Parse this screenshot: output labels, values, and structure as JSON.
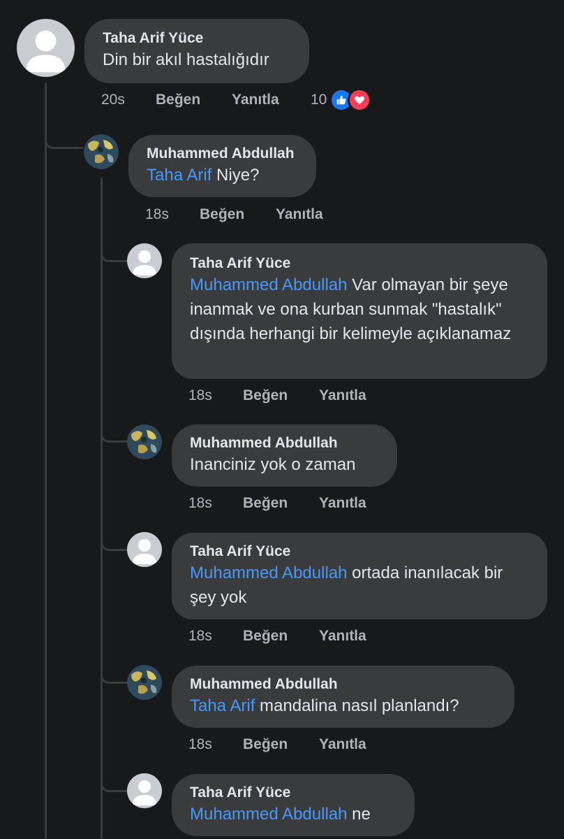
{
  "colors": {
    "background": "#18191a",
    "bubble": "#3a3b3c",
    "mention": "#4599ff",
    "action_text": "#b0b3b8",
    "like_reaction": "#1877f2",
    "love_reaction": "#f33e58"
  },
  "root_comment": {
    "author": "Taha Arif Yüce",
    "text": "Din bir akıl hastalığıdır",
    "time": "20s",
    "like_label": "Beğen",
    "reply_label": "Yanıtla",
    "reaction_count": "10",
    "reaction_icons": [
      "like-icon",
      "love-icon"
    ]
  },
  "replies": [
    {
      "author": "Muhammed Abdullah",
      "mention": "Taha Arif",
      "text": " Niye?",
      "time": "18s",
      "like_label": "Beğen",
      "reply_label": "Yanıtla"
    },
    {
      "author": "Taha Arif Yüce",
      "mention": "Muhammed Abdullah",
      "text": " Var olmayan bir şeye inanmak ve ona kurban sunmak \"hastalık\" dışında herhangi bir kelimeyle açıklanamaz",
      "time": "18s",
      "like_label": "Beğen",
      "reply_label": "Yanıtla"
    },
    {
      "author": "Muhammed Abdullah",
      "mention": "",
      "text": "Inanciniz yok o zaman",
      "time": "18s",
      "like_label": "Beğen",
      "reply_label": "Yanıtla"
    },
    {
      "author": "Taha Arif Yüce",
      "mention": "Muhammed Abdullah",
      "text": " ortada inanılacak bir şey yok",
      "time": "18s",
      "like_label": "Beğen",
      "reply_label": "Yanıtla"
    },
    {
      "author": "Muhammed Abdullah",
      "mention": "Taha Arif",
      "text": " mandalina nasıl planlandı?",
      "time": "18s",
      "like_label": "Beğen",
      "reply_label": "Yanıtla"
    },
    {
      "author": "Taha Arif Yüce",
      "mention": "Muhammed Abdullah",
      "text": " ne",
      "time": "",
      "like_label": "",
      "reply_label": ""
    }
  ]
}
